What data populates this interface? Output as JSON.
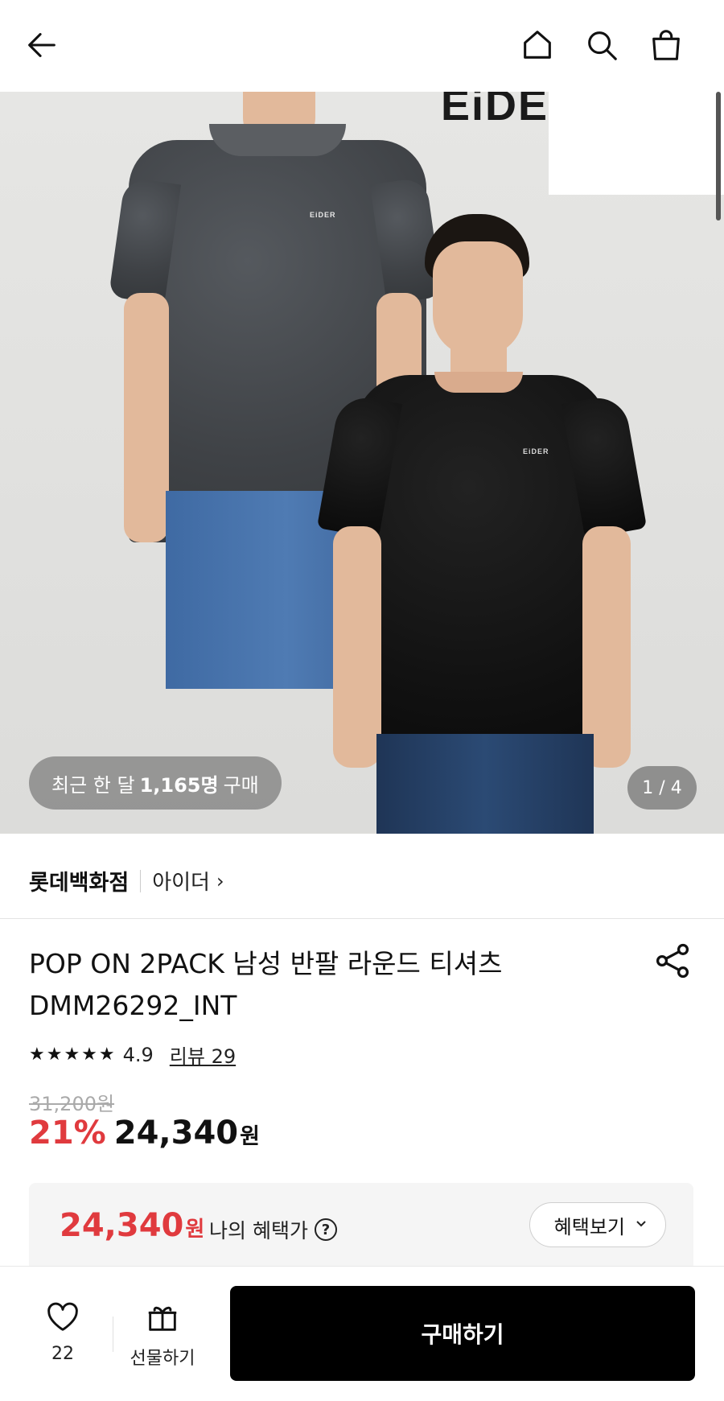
{
  "header": {
    "back_icon": "arrow-left-icon",
    "home_icon": "home-icon",
    "search_icon": "search-icon",
    "cart_icon": "shopping-bag-icon"
  },
  "hero": {
    "logo_text": "EiDER",
    "shirt_brand": "EiDER",
    "buyers_prefix": "최근 한 달",
    "buyers_count": "1,165명",
    "buyers_suffix": "구매",
    "page_counter": "1 / 4"
  },
  "store": {
    "name": "롯데백화점",
    "brand": "아이더",
    "brand_chevron": "›"
  },
  "product": {
    "title_line1": "POP ON 2PACK 남성 반팔 라운드 티셔츠",
    "title_line2": "DMM26292_INT",
    "stars": "★★★★★",
    "rating": "4.9",
    "review_link": "리뷰 29",
    "original_price": "31,200원",
    "discount": "21%",
    "sale_price": "24,340",
    "currency": "원"
  },
  "benefit": {
    "price": "24,340",
    "currency": "원",
    "label": "나의 혜택가",
    "help": "?",
    "button": "혜택보기",
    "button_chevron": "⌄"
  },
  "bottom_bar": {
    "like_count": "22",
    "gift_label": "선물하기",
    "buy_label": "구매하기"
  },
  "colors": {
    "accent_red": "#e03a3e",
    "buy_button": "#000000"
  }
}
